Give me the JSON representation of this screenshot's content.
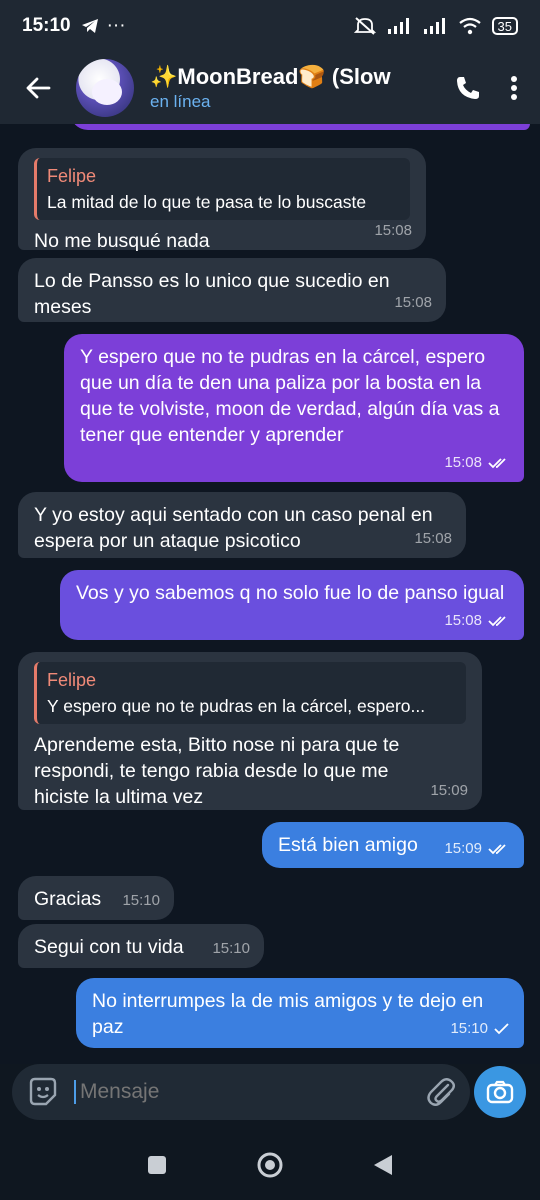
{
  "status_bar": {
    "time": "15:10",
    "battery": "35",
    "dots": "···"
  },
  "header": {
    "title": "✨MoonBread🍞 (Slow",
    "status": "en línea"
  },
  "messages": [
    {
      "reply_name": "Felipe",
      "reply_text": "La mitad de lo que te pasa te lo buscaste",
      "text": "No me busqué nada",
      "time": "15:08"
    },
    {
      "text": "Lo de Pansso es lo unico que sucedio en meses",
      "time": "15:08"
    },
    {
      "text": "Y espero que no te pudras en la cárcel, espero que un día te den una paliza por la bosta en la que te volviste, moon de verdad, algún día vas a tener que entender y aprender",
      "time": "15:08"
    },
    {
      "text": "Y yo estoy aqui sentado con un caso penal en espera por un ataque psicotico",
      "time": "15:08"
    },
    {
      "text": "Vos y yo sabemos q no solo fue lo de panso igual",
      "time": "15:08"
    },
    {
      "reply_name": "Felipe",
      "reply_text": "Y espero que no te pudras en la cárcel, espero...",
      "text": "Aprendeme esta, Bitto nose ni para que te respondi, te tengo rabia desde lo que me hiciste la ultima vez",
      "time": "15:09"
    },
    {
      "text": "Está bien amigo",
      "time": "15:09"
    },
    {
      "text": "Gracias",
      "time": "15:10"
    },
    {
      "text": "Segui con tu vida",
      "time": "15:10"
    },
    {
      "text": "No interrumpes la de mis amigos y te dejo en paz",
      "time": "15:10"
    }
  ],
  "input": {
    "placeholder": "Mensaje"
  },
  "colors": {
    "out_purple": "#7c3fd8",
    "out_violet": "#6a4fde",
    "out_blue": "#3b7fe0",
    "in_bubble": "#2b3440",
    "accent": "#3a97e2"
  }
}
